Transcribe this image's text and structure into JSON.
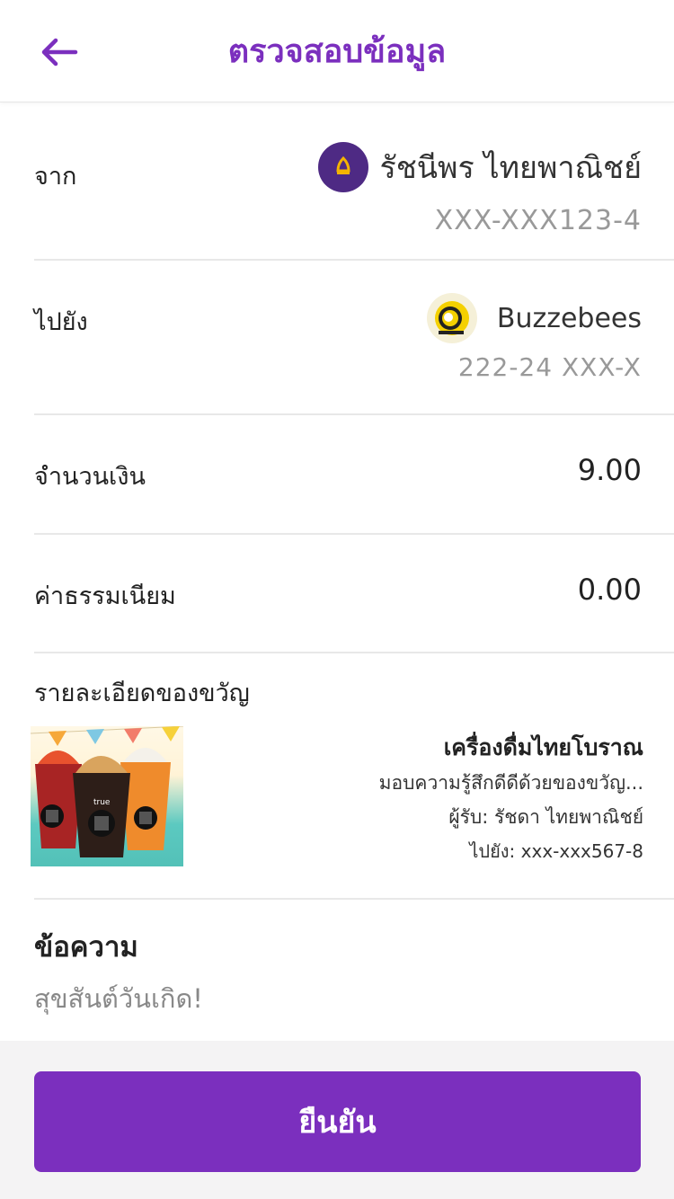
{
  "header": {
    "title": "ตรวจสอบข้อมูล"
  },
  "from": {
    "label": "จาก",
    "name": "รัชนีพร ไทยพาณิชย์",
    "account": "XXX-XXX123-4"
  },
  "to": {
    "label": "ไปยัง",
    "name": "Buzzebees",
    "account": "222-24 XXX-X"
  },
  "amount": {
    "label": "จำนวนเงิน",
    "value": "9.00"
  },
  "fee": {
    "label": "ค่าธรรมเนียม",
    "value": "0.00"
  },
  "gift": {
    "section_label": "รายละเอียดของขวัญ",
    "title": "เครื่องดื่มไทยโบราณ",
    "description": "มอบความรู้สึกดีดีด้วยของขวัญ...",
    "recipient": "ผู้รับ: รัชดา ไทยพาณิชย์",
    "destination": "ไปยัง:  xxx-xxx567-8",
    "cup_brand": "true"
  },
  "message": {
    "label": "ข้อความ",
    "value": "สุขสันต์วันเกิด!"
  },
  "confirm": {
    "label": "ยืนยัน"
  },
  "colors": {
    "primary": "#7b2fbe",
    "bank": "#4e2a84",
    "bank_accent": "#f5b400"
  }
}
